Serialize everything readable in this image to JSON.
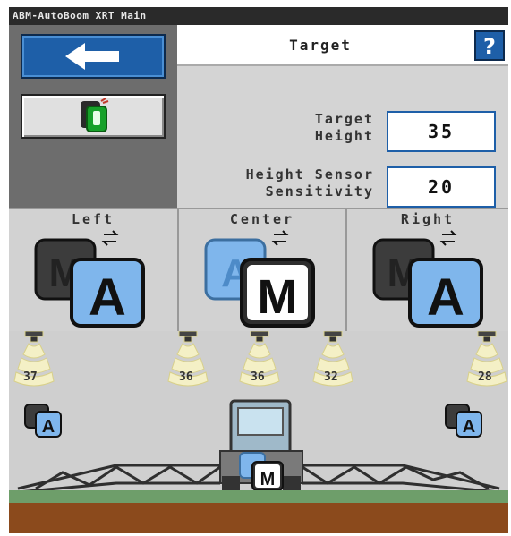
{
  "title": "ABM-AutoBoom XRT Main",
  "target": {
    "title": "Target",
    "help": "?",
    "height_label": "Target\nHeight",
    "height_value": "35",
    "sensitivity_label": "Height Sensor\nSensitivity",
    "sensitivity_value": "20"
  },
  "sections": [
    {
      "label": "Left",
      "mode": "A"
    },
    {
      "label": "Center",
      "mode": "M"
    },
    {
      "label": "Right",
      "mode": "A"
    }
  ],
  "nozzles": [
    "37",
    "36",
    "36",
    "32",
    "28"
  ],
  "field_modes": {
    "left": "A",
    "center": "M",
    "right": "A"
  },
  "colors": {
    "accent": "#1e5fa8",
    "soil": "#8b4a1c",
    "crop": "#6e9e6a"
  }
}
